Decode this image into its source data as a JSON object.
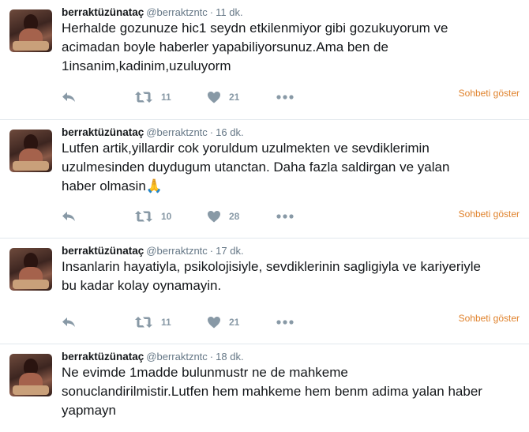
{
  "tweets": [
    {
      "name": "berraktüzünataç",
      "handle": "@berraktzntc",
      "time": "11 dk.",
      "text": "Herhalde gozunuze hic1 seydn etkilenmiyor gibi gozukuyorum ve\nacimadan boyle haberler yapabiliyorsunuz.Ama ben de\n1insanim,kadinim,uzuluyorm",
      "emoji": "",
      "retweets": "11",
      "likes": "21",
      "conversation_label": "Sohbeti göster"
    },
    {
      "name": "berraktüzünataç",
      "handle": "@berraktzntc",
      "time": "16 dk.",
      "text": "Lutfen artik,yillardir cok yoruldum uzulmekten ve sevdiklerimin\nuzulmesinden duydugum utanctan. Daha fazla saldirgan ve yalan\nhaber olmasin",
      "emoji": "🙏",
      "retweets": "10",
      "likes": "28",
      "conversation_label": "Sohbeti göster"
    },
    {
      "name": "berraktüzünataç",
      "handle": "@berraktzntc",
      "time": "17 dk.",
      "text": "Insanlarin hayatiyla, psikolojisiyle, sevdiklerinin sagligiyla ve kariyeriyle\nbu kadar kolay oynamayin.",
      "emoji": "",
      "retweets": "11",
      "likes": "21",
      "conversation_label": "Sohbeti göster"
    },
    {
      "name": "berraktüzünataç",
      "handle": "@berraktzntc",
      "time": "18 dk.",
      "text": "Ne evimde 1madde bulunmustr ne de mahkeme\nsonuclandirilmistir.Lutfen hem mahkeme hem benm adima yalan haber\nyapmayn",
      "emoji": ""
    }
  ],
  "colors": {
    "name": "#14171a",
    "meta": "#657786",
    "action": "#8899a6",
    "conversation": "#e0822c",
    "border": "#e1e8ed"
  },
  "icons": [
    "reply-icon",
    "retweet-icon",
    "like-icon",
    "more-icon"
  ]
}
